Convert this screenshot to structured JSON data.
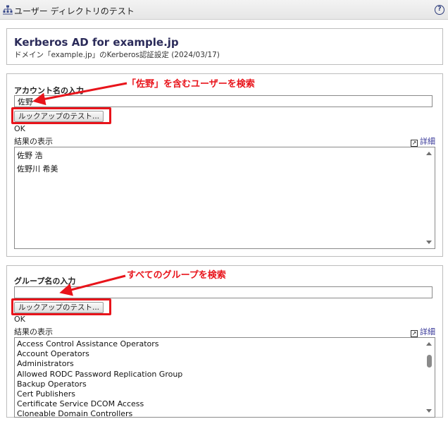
{
  "window": {
    "title": "ユーザー ディレクトリのテスト",
    "help_label": "?"
  },
  "header": {
    "title": "Kerberos AD for example.jp",
    "subtitle": "ドメイン「example.jp」のKerberos認証設定 (2024/03/17)"
  },
  "account": {
    "label": "アカウント名の入力",
    "value": "佐野",
    "lookup_button": "ルックアップのテスト...",
    "status": "OK",
    "results_label": "結果の表示",
    "detail_link": "詳細",
    "results": [
      "佐野 浩",
      "佐野川 希美"
    ]
  },
  "group": {
    "label": "グループ名の入力",
    "value": "",
    "lookup_button": "ルックアップのテスト...",
    "status": "OK",
    "results_label": "結果の表示",
    "detail_link": "詳細",
    "results": [
      "Access Control Assistance Operators",
      "Account Operators",
      "Administrators",
      "Allowed RODC Password Replication Group",
      "Backup Operators",
      "Cert Publishers",
      "Certificate Service DCOM Access",
      "Cloneable Domain Controllers"
    ]
  },
  "annotations": {
    "account_note": "「佐野」を含むユーザーを検索",
    "group_note": "すべてのグループを検索"
  },
  "colors": {
    "annotation": "#e8141b",
    "title": "#2b2b5a"
  },
  "icons": {
    "logo": "directory-tree-icon",
    "help": "help-icon",
    "detail": "external-link-icon"
  }
}
